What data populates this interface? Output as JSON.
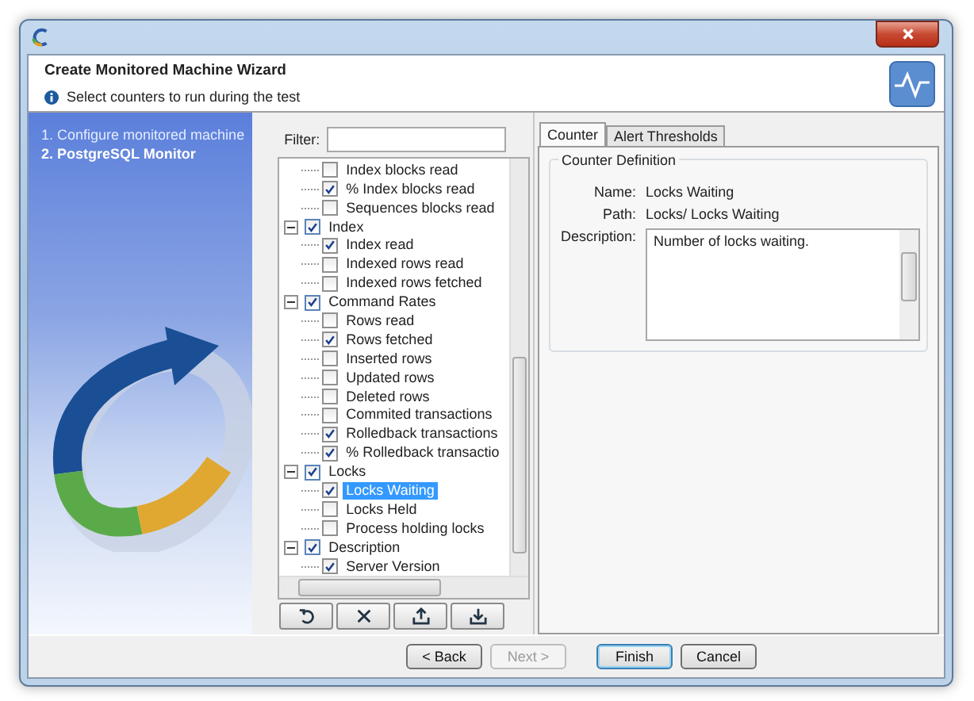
{
  "header": {
    "title": "Create Monitored Machine Wizard",
    "subtitle": "Select counters to run during the test"
  },
  "steps": [
    {
      "label": "1. Configure monitored machine",
      "selected": false
    },
    {
      "label": "2. PostgreSQL Monitor",
      "selected": true
    }
  ],
  "filter": {
    "label": "Filter:"
  },
  "tree": [
    {
      "children": [
        {
          "label": "Index blocks read",
          "checked": false,
          "selected": false
        },
        {
          "label": "% Index blocks read",
          "checked": true,
          "selected": false
        },
        {
          "label": "Sequences blocks read",
          "checked": false,
          "selected": false
        }
      ]
    },
    {
      "label": "Index",
      "checked": true,
      "expanded": true,
      "selected": false,
      "children": [
        {
          "label": "Index read",
          "checked": true,
          "selected": false
        },
        {
          "label": "Indexed rows read",
          "checked": false,
          "selected": false
        },
        {
          "label": "Indexed rows fetched",
          "checked": false,
          "selected": false
        }
      ]
    },
    {
      "label": "Command Rates",
      "checked": true,
      "expanded": true,
      "selected": false,
      "children": [
        {
          "label": "Rows read",
          "checked": false,
          "selected": false
        },
        {
          "label": "Rows fetched",
          "checked": true,
          "selected": false
        },
        {
          "label": "Inserted rows",
          "checked": false,
          "selected": false
        },
        {
          "label": "Updated rows",
          "checked": false,
          "selected": false
        },
        {
          "label": "Deleted rows",
          "checked": false,
          "selected": false
        },
        {
          "label": "Commited transactions",
          "checked": false,
          "selected": false
        },
        {
          "label": "Rolledback transactions",
          "checked": true,
          "selected": false
        },
        {
          "label": "% Rolledback transactio",
          "checked": true,
          "selected": false
        }
      ]
    },
    {
      "label": "Locks",
      "checked": true,
      "expanded": true,
      "selected": false,
      "children": [
        {
          "label": "Locks Waiting",
          "checked": true,
          "selected": true
        },
        {
          "label": "Locks Held",
          "checked": false,
          "selected": false
        },
        {
          "label": "Process holding locks",
          "checked": false,
          "selected": false
        }
      ]
    },
    {
      "label": "Description",
      "checked": true,
      "expanded": true,
      "selected": false,
      "children": [
        {
          "label": "Server Version",
          "checked": true,
          "selected": false
        }
      ]
    }
  ],
  "tabs": [
    {
      "label": "Counter",
      "selected": true
    },
    {
      "label": "Alert Thresholds",
      "selected": false
    }
  ],
  "counter_definition": {
    "title": "Counter Definition",
    "fields": [
      {
        "label": "Name:",
        "value": "Locks Waiting"
      },
      {
        "label": "Path:",
        "value": "Locks/ Locks Waiting"
      }
    ],
    "description": {
      "label": "Description:",
      "value": "Number of locks waiting."
    }
  },
  "buttons": [
    {
      "label": "< Back",
      "disabled": false,
      "default": false
    },
    {
      "label": "Next >",
      "disabled": true,
      "default": false
    },
    {
      "label": "Finish",
      "disabled": false,
      "default": true
    },
    {
      "label": "Cancel",
      "disabled": false,
      "default": false
    }
  ]
}
